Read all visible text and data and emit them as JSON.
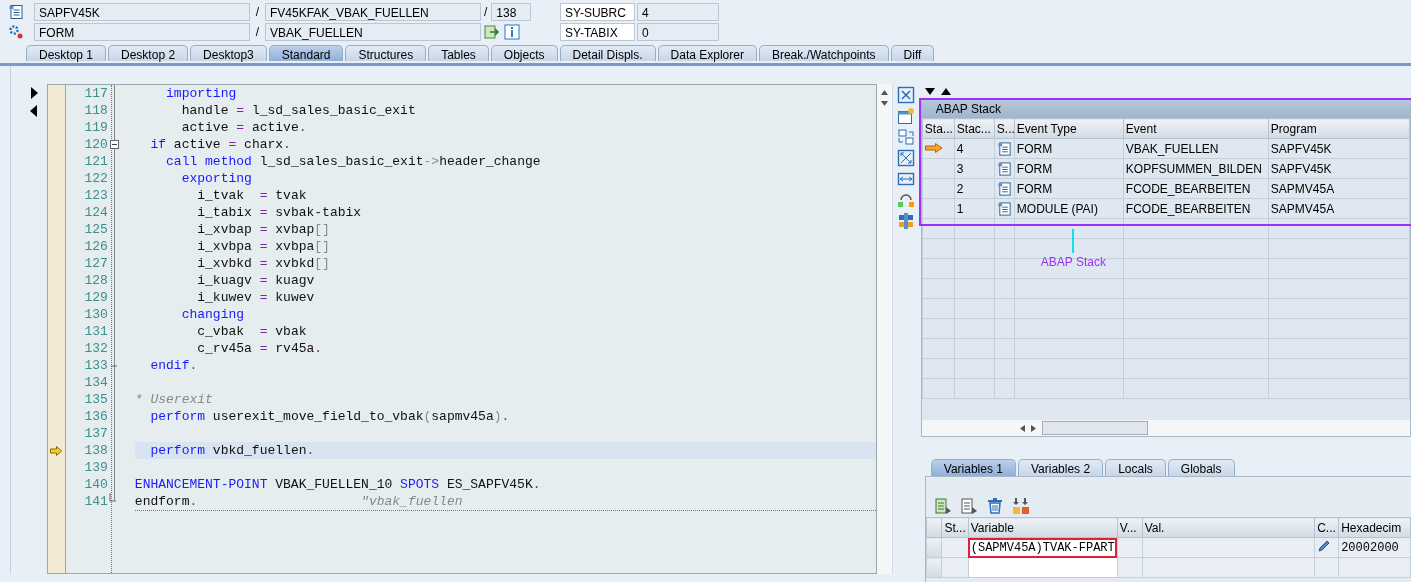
{
  "header_rows": [
    {
      "object": "SAPFV45K",
      "sep": "/",
      "name": "FV45KFAK_VBAK_FUELLEN",
      "extra": {
        "kind": "line",
        "sep": "/",
        "value": "138"
      },
      "sys_field": "SY-SUBRC",
      "sys_value": "4"
    },
    {
      "object": "FORM",
      "sep": "/",
      "name": "VBAK_FUELLEN",
      "extra": {
        "kind": "buttons"
      },
      "sys_field": "SY-TABIX",
      "sys_value": "0"
    }
  ],
  "tabs": [
    {
      "label": "Desktop 1",
      "selected": false
    },
    {
      "label": "Desktop 2",
      "selected": false
    },
    {
      "label": "Desktop3",
      "selected": false
    },
    {
      "label": "Standard",
      "selected": true
    },
    {
      "label": "Structures",
      "selected": false
    },
    {
      "label": "Tables",
      "selected": false
    },
    {
      "label": "Objects",
      "selected": false
    },
    {
      "label": "Detail Displs.",
      "selected": false
    },
    {
      "label": "Data Explorer",
      "selected": false
    },
    {
      "label": "Break./Watchpoints",
      "selected": false
    },
    {
      "label": "Diff",
      "selected": false
    }
  ],
  "code": {
    "lines": [
      {
        "number": "117",
        "current": false,
        "segments": [
          {
            "kind": "keyword",
            "text": "    importing"
          }
        ]
      },
      {
        "number": "118",
        "current": false,
        "segments": [
          {
            "kind": "plain",
            "text": "      handle "
          },
          {
            "kind": "operator",
            "text": "="
          },
          {
            "kind": "plain",
            "text": " l_sd_sales_basic_exit"
          }
        ]
      },
      {
        "number": "119",
        "current": false,
        "segments": [
          {
            "kind": "plain",
            "text": "      active "
          },
          {
            "kind": "operator",
            "text": "="
          },
          {
            "kind": "plain",
            "text": " active"
          },
          {
            "kind": "operator",
            "text": "."
          }
        ]
      },
      {
        "number": "120",
        "current": false,
        "fold_start": true,
        "segments": [
          {
            "kind": "keyword",
            "text": "  if"
          },
          {
            "kind": "plain",
            "text": " active "
          },
          {
            "kind": "operator",
            "text": "="
          },
          {
            "kind": "plain",
            "text": " charx"
          },
          {
            "kind": "operator",
            "text": "."
          }
        ]
      },
      {
        "number": "121",
        "current": false,
        "segments": [
          {
            "kind": "keyword",
            "text": "    call method"
          },
          {
            "kind": "plain",
            "text": " l_sd_sales_basic_exit"
          },
          {
            "kind": "bracket",
            "text": "->"
          },
          {
            "kind": "plain",
            "text": "header_change"
          }
        ]
      },
      {
        "number": "122",
        "current": false,
        "segments": [
          {
            "kind": "keyword",
            "text": "      exporting"
          }
        ]
      },
      {
        "number": "123",
        "current": false,
        "segments": [
          {
            "kind": "plain",
            "text": "        i_tvak  "
          },
          {
            "kind": "operator",
            "text": "="
          },
          {
            "kind": "plain",
            "text": " tvak"
          }
        ]
      },
      {
        "number": "124",
        "current": false,
        "segments": [
          {
            "kind": "plain",
            "text": "        i_tabix "
          },
          {
            "kind": "operator",
            "text": "="
          },
          {
            "kind": "plain",
            "text": " svbak-tabix"
          }
        ]
      },
      {
        "number": "125",
        "current": false,
        "segments": [
          {
            "kind": "plain",
            "text": "        i_xvbap "
          },
          {
            "kind": "operator",
            "text": "="
          },
          {
            "kind": "plain",
            "text": " xvbap"
          },
          {
            "kind": "bracket",
            "text": "[]"
          }
        ]
      },
      {
        "number": "126",
        "current": false,
        "segments": [
          {
            "kind": "plain",
            "text": "        i_xvbpa "
          },
          {
            "kind": "operator",
            "text": "="
          },
          {
            "kind": "plain",
            "text": " xvbpa"
          },
          {
            "kind": "bracket",
            "text": "[]"
          }
        ]
      },
      {
        "number": "127",
        "current": false,
        "segments": [
          {
            "kind": "plain",
            "text": "        i_xvbkd "
          },
          {
            "kind": "operator",
            "text": "="
          },
          {
            "kind": "plain",
            "text": " xvbkd"
          },
          {
            "kind": "bracket",
            "text": "[]"
          }
        ]
      },
      {
        "number": "128",
        "current": false,
        "segments": [
          {
            "kind": "plain",
            "text": "        i_kuagv "
          },
          {
            "kind": "operator",
            "text": "="
          },
          {
            "kind": "plain",
            "text": " kuagv"
          }
        ]
      },
      {
        "number": "129",
        "current": false,
        "segments": [
          {
            "kind": "plain",
            "text": "        i_kuwev "
          },
          {
            "kind": "operator",
            "text": "="
          },
          {
            "kind": "plain",
            "text": " kuwev"
          }
        ]
      },
      {
        "number": "130",
        "current": false,
        "segments": [
          {
            "kind": "keyword",
            "text": "      changing"
          }
        ]
      },
      {
        "number": "131",
        "current": false,
        "segments": [
          {
            "kind": "plain",
            "text": "        c_vbak  "
          },
          {
            "kind": "operator",
            "text": "="
          },
          {
            "kind": "plain",
            "text": " vbak"
          }
        ]
      },
      {
        "number": "132",
        "current": false,
        "segments": [
          {
            "kind": "plain",
            "text": "        c_rv45a "
          },
          {
            "kind": "operator",
            "text": "="
          },
          {
            "kind": "plain",
            "text": " rv45a"
          },
          {
            "kind": "operator",
            "text": "."
          }
        ]
      },
      {
        "number": "133",
        "current": false,
        "fold_end": true,
        "segments": [
          {
            "kind": "keyword",
            "text": "  endif"
          },
          {
            "kind": "operator",
            "text": "."
          }
        ]
      },
      {
        "number": "134",
        "current": false
      },
      {
        "number": "135",
        "current": false,
        "segments": [
          {
            "kind": "comment",
            "text": "* Userexit"
          }
        ]
      },
      {
        "number": "136",
        "current": false,
        "segments": [
          {
            "kind": "keyword",
            "text": "  perform"
          },
          {
            "kind": "plain",
            "text": " userexit_move_field_to_vbak"
          },
          {
            "kind": "bracket",
            "text": "("
          },
          {
            "kind": "plain",
            "text": "sapmv45a"
          },
          {
            "kind": "bracket",
            "text": ")"
          },
          {
            "kind": "operator",
            "text": "."
          }
        ]
      },
      {
        "number": "137",
        "current": false
      },
      {
        "number": "138",
        "current": true,
        "segments": [
          {
            "kind": "keyword",
            "text": "  perform"
          },
          {
            "kind": "plain",
            "text": " vbkd_fuellen"
          },
          {
            "kind": "operator",
            "text": "."
          }
        ]
      },
      {
        "number": "139",
        "current": false
      },
      {
        "number": "140",
        "current": false,
        "segments": [
          {
            "kind": "keyword",
            "text": "ENHANCEMENT-POINT"
          },
          {
            "kind": "plain",
            "text": " VBAK_FUELLEN_10 "
          },
          {
            "kind": "keyword",
            "text": "SPOTS"
          },
          {
            "kind": "plain",
            "text": " ES_SAPFV45K"
          },
          {
            "kind": "operator",
            "text": "."
          }
        ]
      },
      {
        "number": "141",
        "current": false,
        "fold_end": true,
        "segments": [
          {
            "kind": "plain",
            "text": "endform"
          },
          {
            "kind": "operator",
            "text": "."
          },
          {
            "kind": "comment",
            "text": "                     \"vbak_fuellen"
          }
        ]
      }
    ]
  },
  "stack": {
    "title": "ABAP Stack",
    "columns": [
      "Sta...",
      "Stac...",
      "S...",
      "Event Type",
      "Event",
      "Program"
    ],
    "rows": [
      {
        "current": true,
        "level": "4",
        "event_type": "FORM",
        "event": "VBAK_FUELLEN",
        "program": "SAPFV45K"
      },
      {
        "current": false,
        "level": "3",
        "event_type": "FORM",
        "event": "KOPFSUMMEN_BILDEN",
        "program": "SAPFV45K"
      },
      {
        "current": false,
        "level": "2",
        "event_type": "FORM",
        "event": "FCODE_BEARBEITEN",
        "program": "SAPMV45A"
      },
      {
        "current": false,
        "level": "1",
        "event_type": "MODULE (PAI)",
        "event": "FCODE_BEARBEITEN",
        "program": "SAPMV45A"
      }
    ],
    "callout": "ABAP Stack"
  },
  "variables": {
    "tabs": [
      {
        "label": "Variables 1",
        "selected": true
      },
      {
        "label": "Variables 2",
        "selected": false
      },
      {
        "label": "Locals",
        "selected": false
      },
      {
        "label": "Globals",
        "selected": false
      }
    ],
    "columns": [
      "St...",
      "Variable",
      "V...",
      "Val.",
      "C...",
      "Hexadecim"
    ],
    "rows": [
      {
        "variable": "(SAPMV45A)TVAK-FPART",
        "hex": "20002000",
        "highlighted": true
      }
    ]
  }
}
